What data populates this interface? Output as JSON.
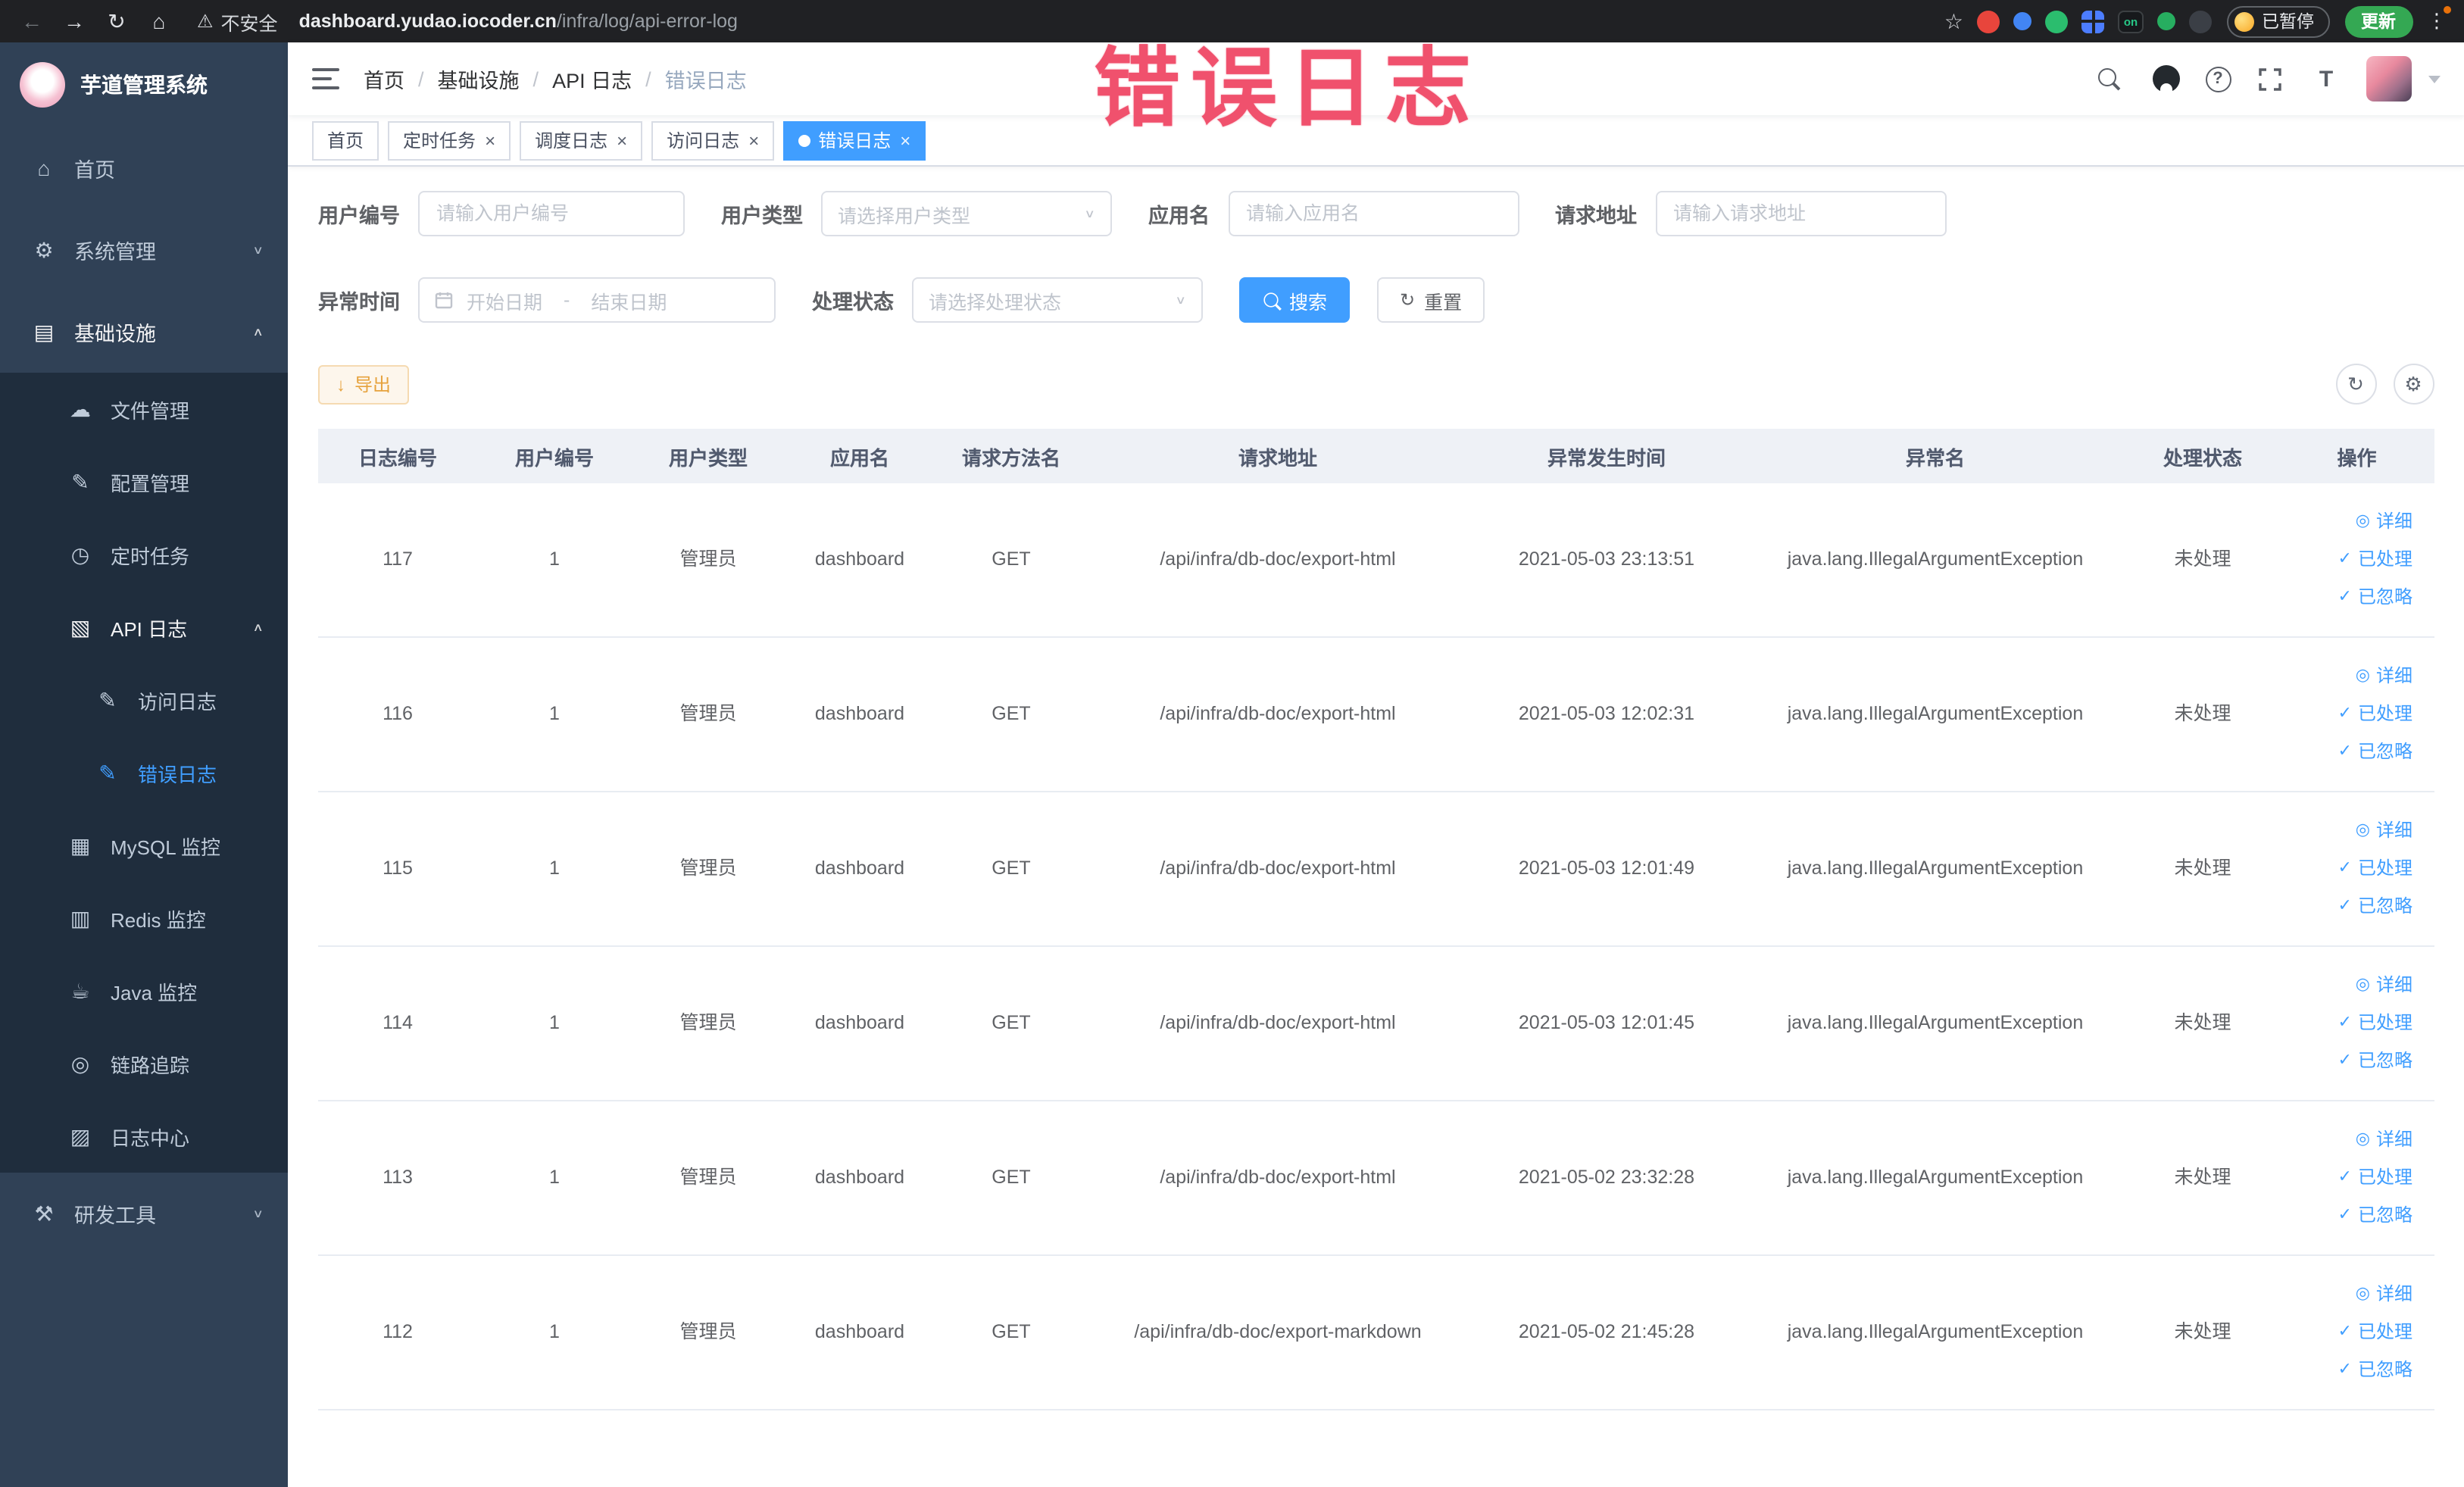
{
  "watermark": "错误日志",
  "colors": {
    "primary": "#409EFF",
    "warning": "#e6a23c",
    "sidebar_bg": "#304156",
    "submenu_bg": "#1f2d3d",
    "watermark_pink": "#f0516d",
    "chrome_bg": "#202124",
    "update_green": "#34a853"
  },
  "browser": {
    "security_label": "不安全",
    "url_domain": "dashboard.yudao.iocoder.cn",
    "url_path": "/infra/log/api-error-log",
    "paused_label": "已暂停",
    "update_label": "更新",
    "ext_on_label": "on",
    "icons": {
      "back": "←",
      "forward": "→",
      "reload": "↻",
      "home": "⌂",
      "warning": "⚠",
      "star": "☆",
      "menu": "⋮"
    }
  },
  "icon_glyphs": {
    "select_arrow": "∨",
    "tab_close": "×",
    "breadcrumb_sep": "/",
    "reset": "↻",
    "export_arrow": "↓",
    "refresh": "↻",
    "settings": "⚙",
    "help": "?",
    "font_size": "T"
  },
  "sidebar": {
    "app_title": "芋道管理系统",
    "items": [
      {
        "key": "home",
        "label": "首页",
        "icon": "home-icon",
        "glyph": "⌂",
        "level": 1
      },
      {
        "key": "system",
        "label": "系统管理",
        "icon": "gear-icon",
        "glyph": "⚙",
        "level": 1,
        "arrow": "down"
      },
      {
        "key": "infra",
        "label": "基础设施",
        "icon": "infra-icon",
        "glyph": "▤",
        "level": 1,
        "arrow": "up",
        "trail": true
      },
      {
        "key": "file",
        "label": "文件管理",
        "icon": "cloud-icon",
        "glyph": "☁",
        "level": 2
      },
      {
        "key": "config",
        "label": "配置管理",
        "icon": "edit-icon",
        "glyph": "✎",
        "level": 2
      },
      {
        "key": "job",
        "label": "定时任务",
        "icon": "timer-icon",
        "glyph": "◷",
        "level": 2
      },
      {
        "key": "api-log",
        "label": "API 日志",
        "icon": "api-log-icon",
        "glyph": "▧",
        "level": 2,
        "arrow": "up",
        "trail": true
      },
      {
        "key": "access-log",
        "label": "访问日志",
        "icon": "access-log-icon",
        "glyph": "✎",
        "level": 3
      },
      {
        "key": "error-log",
        "label": "错误日志",
        "icon": "error-log-icon",
        "glyph": "✎",
        "level": 3,
        "active": true
      },
      {
        "key": "mysql",
        "label": "MySQL 监控",
        "icon": "mysql-icon",
        "glyph": "▦",
        "level": 2
      },
      {
        "key": "redis",
        "label": "Redis 监控",
        "icon": "redis-icon",
        "glyph": "▥",
        "level": 2
      },
      {
        "key": "java",
        "label": "Java 监控",
        "icon": "java-icon",
        "glyph": "☕",
        "level": 2
      },
      {
        "key": "trace",
        "label": "链路追踪",
        "icon": "trace-icon",
        "glyph": "◎",
        "level": 2
      },
      {
        "key": "log-center",
        "label": "日志中心",
        "icon": "log-center-icon",
        "glyph": "▨",
        "level": 2
      },
      {
        "key": "dev-tools",
        "label": "研发工具",
        "icon": "tools-icon",
        "glyph": "⚒",
        "level": 1,
        "arrow": "down"
      }
    ]
  },
  "header": {
    "breadcrumb": [
      "首页",
      "基础设施",
      "API 日志",
      "错误日志"
    ]
  },
  "tabs": [
    {
      "key": "home",
      "label": "首页",
      "closable": false,
      "active": false
    },
    {
      "key": "scheduled-jobs",
      "label": "定时任务",
      "closable": true,
      "active": false
    },
    {
      "key": "job-log",
      "label": "调度日志",
      "closable": true,
      "active": false
    },
    {
      "key": "access-log",
      "label": "访问日志",
      "closable": true,
      "active": false
    },
    {
      "key": "error-log",
      "label": "错误日志",
      "closable": true,
      "active": true
    }
  ],
  "filters": {
    "user_id": {
      "label": "用户编号",
      "placeholder": "请输入用户编号"
    },
    "user_type": {
      "label": "用户类型",
      "placeholder": "请选择用户类型"
    },
    "app_name": {
      "label": "应用名",
      "placeholder": "请输入应用名"
    },
    "request_url": {
      "label": "请求地址",
      "placeholder": "请输入请求地址"
    },
    "exception_time": {
      "label": "异常时间",
      "start_placeholder": "开始日期",
      "separator": "-",
      "end_placeholder": "结束日期"
    },
    "process_status": {
      "label": "处理状态",
      "placeholder": "请选择处理状态"
    },
    "search_label": "搜索",
    "reset_label": "重置"
  },
  "toolbar": {
    "export_label": "导出"
  },
  "table": {
    "columns": [
      {
        "key": "log_id",
        "label": "日志编号"
      },
      {
        "key": "user_id",
        "label": "用户编号"
      },
      {
        "key": "user_type",
        "label": "用户类型"
      },
      {
        "key": "app_name",
        "label": "应用名"
      },
      {
        "key": "method",
        "label": "请求方法名"
      },
      {
        "key": "url",
        "label": "请求地址"
      },
      {
        "key": "time",
        "label": "异常发生时间"
      },
      {
        "key": "exception",
        "label": "异常名"
      },
      {
        "key": "status",
        "label": "处理状态"
      },
      {
        "key": "actions",
        "label": "操作"
      }
    ],
    "actions": [
      {
        "key": "detail",
        "label": "详细",
        "icon": "eye-icon",
        "glyph": "◎"
      },
      {
        "key": "processed",
        "label": "已处理",
        "icon": "check-icon",
        "glyph": "✓"
      },
      {
        "key": "ignored",
        "label": "已忽略",
        "icon": "check-icon",
        "glyph": "✓"
      }
    ],
    "rows": [
      {
        "log_id": "117",
        "user_id": "1",
        "user_type": "管理员",
        "app_name": "dashboard",
        "method": "GET",
        "url": "/api/infra/db-doc/export-html",
        "time": "2021-05-03 23:13:51",
        "exception": "java.lang.IllegalArgumentException",
        "status": "未处理"
      },
      {
        "log_id": "116",
        "user_id": "1",
        "user_type": "管理员",
        "app_name": "dashboard",
        "method": "GET",
        "url": "/api/infra/db-doc/export-html",
        "time": "2021-05-03 12:02:31",
        "exception": "java.lang.IllegalArgumentException",
        "status": "未处理"
      },
      {
        "log_id": "115",
        "user_id": "1",
        "user_type": "管理员",
        "app_name": "dashboard",
        "method": "GET",
        "url": "/api/infra/db-doc/export-html",
        "time": "2021-05-03 12:01:49",
        "exception": "java.lang.IllegalArgumentException",
        "status": "未处理"
      },
      {
        "log_id": "114",
        "user_id": "1",
        "user_type": "管理员",
        "app_name": "dashboard",
        "method": "GET",
        "url": "/api/infra/db-doc/export-html",
        "time": "2021-05-03 12:01:45",
        "exception": "java.lang.IllegalArgumentException",
        "status": "未处理"
      },
      {
        "log_id": "113",
        "user_id": "1",
        "user_type": "管理员",
        "app_name": "dashboard",
        "method": "GET",
        "url": "/api/infra/db-doc/export-html",
        "time": "2021-05-02 23:32:28",
        "exception": "java.lang.IllegalArgumentException",
        "status": "未处理"
      },
      {
        "log_id": "112",
        "user_id": "1",
        "user_type": "管理员",
        "app_name": "dashboard",
        "method": "GET",
        "url": "/api/infra/db-doc/export-markdown",
        "time": "2021-05-02 21:45:28",
        "exception": "java.lang.IllegalArgumentException",
        "status": "未处理"
      }
    ]
  }
}
